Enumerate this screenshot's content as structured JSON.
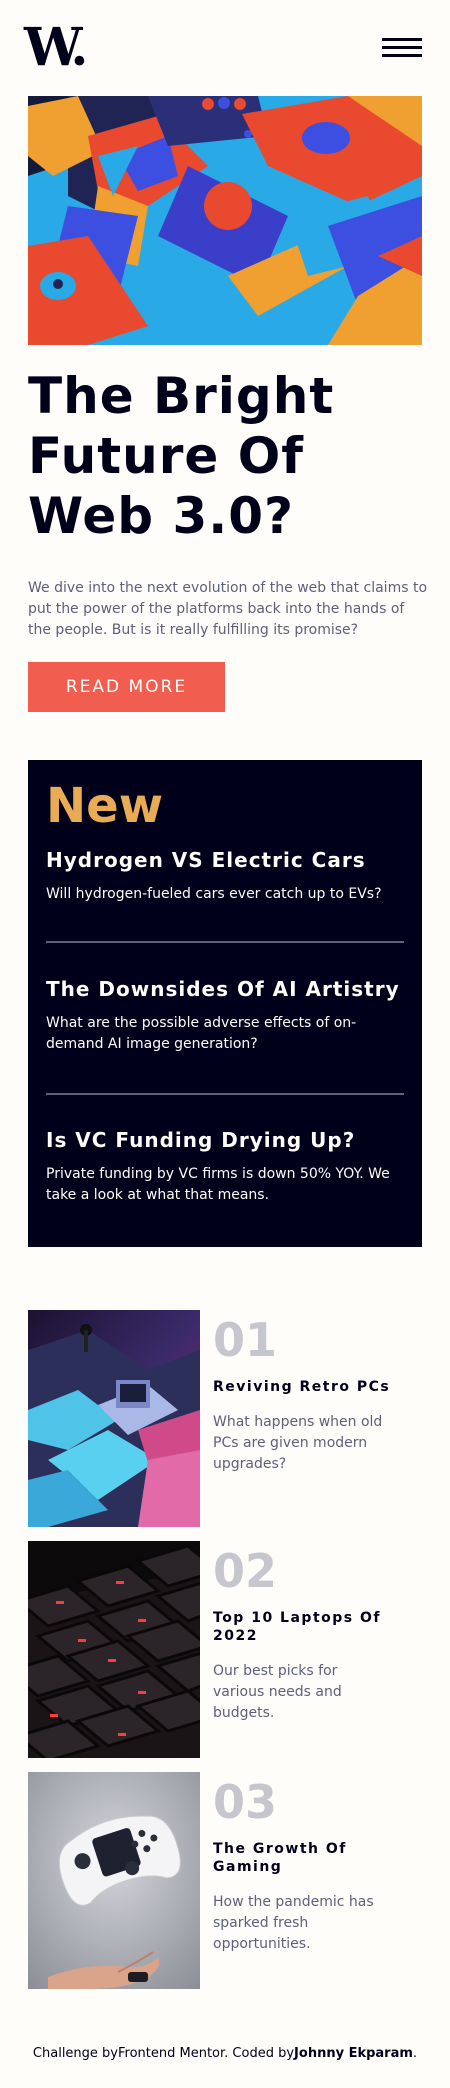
{
  "header": {
    "logo_text": "W",
    "logo_dot": ".",
    "menu_icon": "hamburger-menu-icon"
  },
  "hero": {
    "image": "hero-geometric-3d-shapes",
    "title": "The Bright Future Of Web 3.0?",
    "description": "We dive into the next evolution of the web that claims to put the power of the platforms back into the hands of the people. But is it really fulfilling its promise?",
    "button_label": "Read more"
  },
  "new_panel": {
    "heading": "New",
    "items": [
      {
        "title": "Hydrogen VS Electric Cars",
        "description": "Will hydrogen-fueled cars ever catch up to EVs?"
      },
      {
        "title": "The Downsides Of AI Artistry",
        "description": "What are the possible adverse effects of on-demand AI image generation?"
      },
      {
        "title": "Is VC Funding Drying Up?",
        "description": "Private funding by VC firms is down 50% YOY. We take a look at what that means."
      }
    ]
  },
  "articles": [
    {
      "number": "01",
      "title": "Reviving Retro PCs",
      "description": "What happens when old PCs are given modern upgrades?",
      "image": "retro-pc-image"
    },
    {
      "number": "02",
      "title": "Top 10 Laptops Of 2022",
      "description": "Our best picks for various needs and budgets.",
      "image": "laptop-keyboard-image"
    },
    {
      "number": "03",
      "title": "The Growth Of Gaming",
      "description": "How the pandemic has sparked fresh opportunities.",
      "image": "gaming-controller-image"
    }
  ],
  "footer": {
    "prefix": "Challenge by",
    "challenge_link": "Frontend Mentor",
    "middle": ". Coded by",
    "author_link": "Johnny Ekparam",
    "suffix": "."
  },
  "colors": {
    "accent_red": "#f15e50",
    "accent_orange": "#e9ab53",
    "dark_navy": "#00001a",
    "grayish_blue": "#5e607a",
    "grayish_light": "#c5c6ce",
    "off_white": "#fffdfa"
  }
}
